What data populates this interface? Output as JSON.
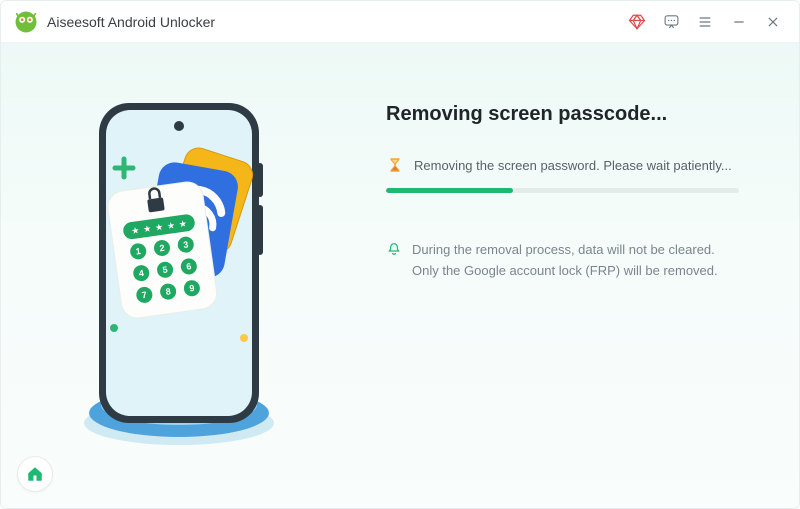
{
  "app": {
    "title": "Aiseesoft Android Unlocker"
  },
  "main": {
    "heading": "Removing screen passcode...",
    "status_text": "Removing the screen password. Please wait patiently...",
    "progress_percent": 36,
    "note_text": "During the removal process, data will not be cleared. Only the Google account lock (FRP) will be removed."
  },
  "colors": {
    "accent_green": "#1fb872"
  }
}
